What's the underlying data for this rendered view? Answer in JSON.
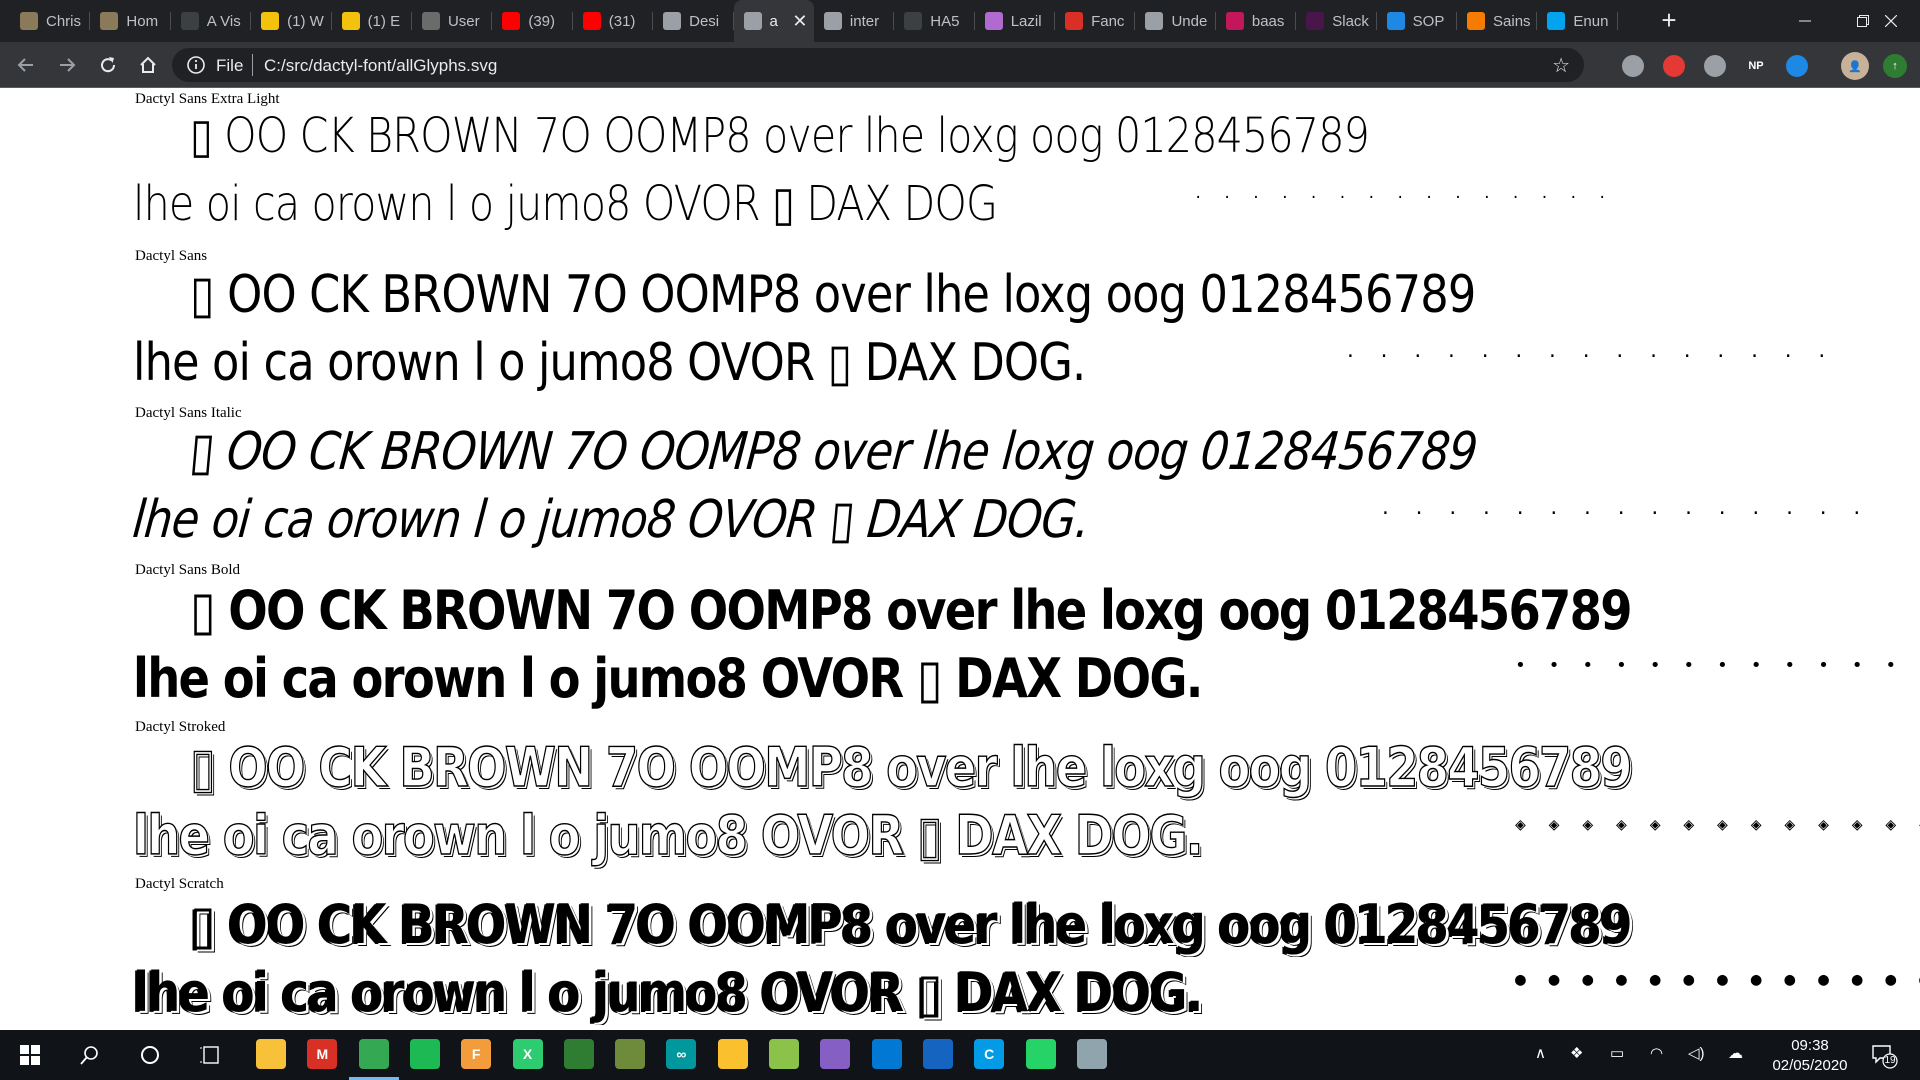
{
  "browser": {
    "tabs": [
      {
        "title": "Chris",
        "favicon": "avatar-favicon",
        "color": "#8a7a5a"
      },
      {
        "title": "Hom",
        "favicon": "avatar-favicon",
        "color": "#8a7a5a"
      },
      {
        "title": "A Vis",
        "favicon": "circle-favicon",
        "color": "#3c4043"
      },
      {
        "title": "(1) W",
        "favicon": "g-favicon",
        "color": "#f4c20d"
      },
      {
        "title": "(1) E",
        "favicon": "g-favicon",
        "color": "#f4c20d"
      },
      {
        "title": "User",
        "favicon": "user-favicon",
        "color": "#6b6b6b"
      },
      {
        "title": "(39)",
        "favicon": "youtube-favicon",
        "color": "#ff0000"
      },
      {
        "title": "(31)",
        "favicon": "youtube-favicon",
        "color": "#ff0000"
      },
      {
        "title": "Desi",
        "favicon": "globe-favicon",
        "color": "#9aa0a6"
      },
      {
        "title": "a",
        "favicon": "globe-favicon",
        "color": "#9aa0a6",
        "active": true
      },
      {
        "title": "inter",
        "favicon": "globe-favicon",
        "color": "#9aa0a6"
      },
      {
        "title": "HA5",
        "favicon": "dots-favicon",
        "color": "#3c4043"
      },
      {
        "title": "Lazil",
        "favicon": "cursor-favicon",
        "color": "#b06ad0"
      },
      {
        "title": "Fanc",
        "favicon": "fancy-favicon",
        "color": "#d93025"
      },
      {
        "title": "Unde",
        "favicon": "globe-favicon",
        "color": "#9aa0a6"
      },
      {
        "title": "baas",
        "favicon": "bookmark-favicon",
        "color": "#c2185b"
      },
      {
        "title": "Slack",
        "favicon": "slack-favicon",
        "color": "#4a154b"
      },
      {
        "title": "SOP",
        "favicon": "sop-favicon",
        "color": "#1e88e5"
      },
      {
        "title": "Sains",
        "favicon": "s-favicon",
        "color": "#f57c00"
      },
      {
        "title": "Enun",
        "favicon": "windows-favicon",
        "color": "#00a4ef"
      }
    ],
    "new_tab": "+",
    "tab_close": "✕",
    "address": {
      "scheme": "File",
      "url": "C:/src/dactyl-font/allGlyphs.svg"
    },
    "extensions": [
      {
        "name": "shield-extension-icon",
        "label": "",
        "color": "#9aa0a6"
      },
      {
        "name": "red-extension-icon",
        "label": "",
        "color": "#e53935"
      },
      {
        "name": "paw-extension-icon",
        "label": "",
        "color": "#9aa0a6"
      },
      {
        "name": "np-extension-icon",
        "label": "NP",
        "color": "#35363a"
      },
      {
        "name": "drop-extension-icon",
        "label": "",
        "color": "#1e88e5"
      }
    ]
  },
  "page": {
    "sections": [
      {
        "font": "Dactyl Sans Extra Light",
        "line1": "▯ OO CK BROWN 7O  OOMP8 over lhe loxg oog 0128456789",
        "line2": "lhe oi ca orown l o  jumo8 OVOR  ▯ DAX DOG",
        "dots": ". . . . . . . . . . . . . . ."
      },
      {
        "font": "Dactyl Sans",
        "line1": "▯ OO CK BROWN 7O  OOMP8 over lhe loxg oog 0128456789",
        "line2": "lhe oi ca orown l o  jumo8 OVOR  ▯ DAX DOG.",
        "dots": ". . . . . . . . . . . . . . ."
      },
      {
        "font": "Dactyl Sans Italic",
        "line1": "▯ OO CK BROWN 7O  OOMP8 over lhe loxg oog 0128456789",
        "line2": "lhe oi ca orown l o  jumo8 OVOR  ▯ DAX DOG.",
        "dots": ". . . . . . . . . . . . . . ."
      },
      {
        "font": "Dactyl Sans Bold",
        "line1": "▯ OO CK BROWN 7O  OOMP8 over lhe loxg oog 0128456789",
        "line2": "lhe oi ca orown l o  jumo8 OVOR  ▯ DAX DOG.",
        "dots": "• • • • • • • • • • • • • • •"
      },
      {
        "font": "Dactyl Stroked",
        "line1": "▯ OO CK BROWN 7O  OOMP8 over lhe loxg oog 0128456789",
        "line2": "lhe oi ca orown l o  jumo8 OVOR  ▯ DAX DOG.",
        "dots": "◈ ◈ ◈ ◈ ◈ ◈ ◈ ◈ ◈ ◈ ◈ ◈ ◈ ◈ ◈"
      },
      {
        "font": "Dactyl Scratch",
        "line1": "▯ OO CK BROWN 7O  OOMP8 over lhe loxg oog 0128456789",
        "line2": "lhe oi ca orown l o  jumo8 OVOR  ▯ DAX DOG.",
        "dots": "● ● ● ● ● ● ● ● ● ● ● ● ● ● ●"
      }
    ]
  },
  "taskbar": {
    "apps": [
      {
        "name": "file-explorer-icon",
        "color": "#f8c13a",
        "label": ""
      },
      {
        "name": "gmail-icon",
        "color": "#d93025",
        "label": "M"
      },
      {
        "name": "chrome-icon",
        "color": "#34a853",
        "label": "",
        "active": true
      },
      {
        "name": "spotify-icon",
        "color": "#1db954",
        "label": ""
      },
      {
        "name": "fontforge-icon",
        "color": "#f39c3b",
        "label": "F"
      },
      {
        "name": "xmind-icon",
        "color": "#2ecc71",
        "label": "X"
      },
      {
        "name": "monitor-icon",
        "color": "#2e7d32",
        "label": ""
      },
      {
        "name": "inkscape-icon",
        "color": "#6d8b3a",
        "label": ""
      },
      {
        "name": "arduino-icon",
        "color": "#00979d",
        "label": "∞"
      },
      {
        "name": "bulb-icon",
        "color": "#fbc02d",
        "label": ""
      },
      {
        "name": "globe-app-icon",
        "color": "#8bc34a",
        "label": ""
      },
      {
        "name": "visual-studio-icon",
        "color": "#865fc5",
        "label": ""
      },
      {
        "name": "vscode-icon",
        "color": "#0078d4",
        "label": ""
      },
      {
        "name": "window-app-icon",
        "color": "#1565c0",
        "label": ""
      },
      {
        "name": "c-app-icon",
        "color": "#039be5",
        "label": "C"
      },
      {
        "name": "whatsapp-icon",
        "color": "#25d366",
        "label": ""
      },
      {
        "name": "remote-icon",
        "color": "#90a4ae",
        "label": ""
      }
    ],
    "clock_time": "09:38",
    "clock_date": "02/05/2020",
    "notifications": "19"
  }
}
